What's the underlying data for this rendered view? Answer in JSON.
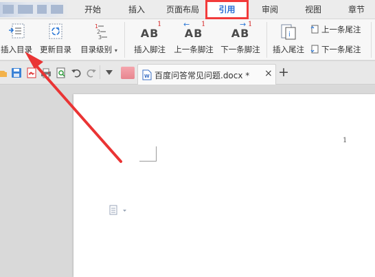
{
  "menu": {
    "tabs": [
      {
        "label": "开始"
      },
      {
        "label": "插入"
      },
      {
        "label": "页面布局"
      },
      {
        "label": "引用",
        "active": true
      },
      {
        "label": "审阅"
      },
      {
        "label": "视图"
      },
      {
        "label": "章节"
      }
    ]
  },
  "ribbon": {
    "insert_toc": "插入目录",
    "update_toc": "更新目录",
    "toc_level": "目录级别",
    "insert_footnote": "插入脚注",
    "prev_footnote": "上一条脚注",
    "next_footnote": "下一条脚注",
    "insert_endnote": "插入尾注",
    "prev_endnote": "上一条尾注",
    "next_endnote": "下一条尾注",
    "footnote_sup": "1",
    "ab_text": "AB",
    "toc_numbers": [
      "1",
      "2",
      "3"
    ]
  },
  "document_tab": {
    "filename": "百度问答常见问题.docx *",
    "close_symbol": "×",
    "new_tab_symbol": "+"
  },
  "page": {
    "page_number": "1"
  },
  "colors": {
    "highlight_red": "#f23b3b",
    "active_tab_text": "#2a6fd6",
    "footnote_red": "#d42a2a"
  }
}
